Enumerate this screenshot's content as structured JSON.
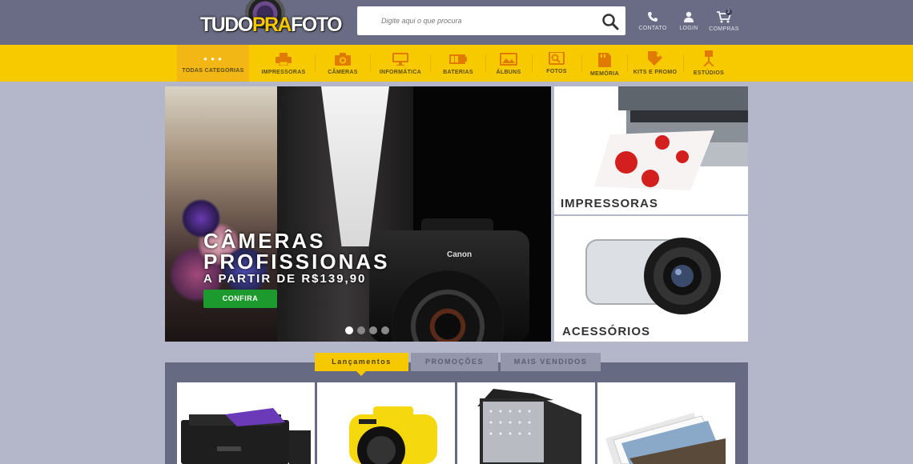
{
  "header": {
    "logo": {
      "part1": "TUDO",
      "part2": "PRA",
      "part3": "FOTO"
    },
    "search": {
      "placeholder": "Digite aqui o que procura",
      "value": ""
    },
    "links": [
      {
        "label": "CONTATO",
        "icon": "phone-icon"
      },
      {
        "label": "LOGIN",
        "icon": "user-icon"
      },
      {
        "label": "COMPRAS",
        "icon": "cart-icon",
        "badge": "2"
      }
    ]
  },
  "categories": [
    {
      "label": "TODAS CATEGORIAS",
      "icon": "dots-icon",
      "active": true
    },
    {
      "label": "IMPRESSORAS",
      "icon": "printer-icon"
    },
    {
      "label": "CÂMERAS",
      "icon": "camera-icon"
    },
    {
      "label": "INFORMÁTICA",
      "icon": "monitor-icon"
    },
    {
      "label": "BATERIAS",
      "icon": "battery-icon"
    },
    {
      "label": "ÁLBUNS",
      "icon": "album-icon"
    },
    {
      "label": "FOTOS",
      "icon": "photos-icon"
    },
    {
      "label": "MEMÓRIA",
      "icon": "memory-card-icon"
    },
    {
      "label": "KITS E PROMO",
      "icon": "tag-icon"
    },
    {
      "label": "ESTÚDIOS",
      "icon": "studio-light-icon"
    }
  ],
  "hero": {
    "title_line1": "CÂMERAS",
    "title_line2": "PROFISSIONAS",
    "subtitle": "A PARTIR DE R$139,90",
    "button": "CONFIRA",
    "camera_brand": "Canon",
    "slides": 4,
    "active_slide": 1
  },
  "side_banners": [
    {
      "label": "IMPRESSORAS"
    },
    {
      "label": "ACESSÓRIOS"
    }
  ],
  "tabs": [
    {
      "label": "Lançamentos",
      "active": true
    },
    {
      "label": "PROMOÇÕES",
      "active": false
    },
    {
      "label": "MAIS VENDIDOS",
      "active": false
    }
  ],
  "products": [
    {
      "name": "printer-product"
    },
    {
      "name": "camera-product"
    },
    {
      "name": "studio-light-product"
    },
    {
      "name": "photo-prints-product"
    }
  ],
  "colors": {
    "header_bg": "#696c84",
    "nav_bg": "#f7ca00",
    "page_bg": "#b4b7c9",
    "cta_green": "#1d9a2e"
  }
}
